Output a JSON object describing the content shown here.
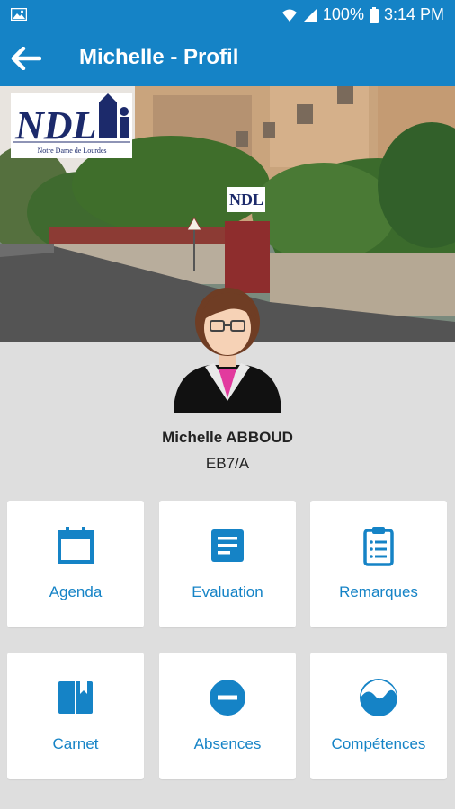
{
  "status_bar": {
    "battery": "100%",
    "time": "3:14 PM"
  },
  "app_bar": {
    "title": "Michelle - Profil"
  },
  "banner": {
    "logo_text": "NDL",
    "logo_subtitle": "Notre Dame de Lourdes"
  },
  "profile": {
    "name": "Michelle ABBOUD",
    "class": "EB7/A"
  },
  "tiles": [
    {
      "label": "Agenda",
      "icon": "calendar-icon"
    },
    {
      "label": "Evaluation",
      "icon": "document-icon"
    },
    {
      "label": "Remarques",
      "icon": "clipboard-icon"
    },
    {
      "label": "Carnet",
      "icon": "book-icon"
    },
    {
      "label": "Absences",
      "icon": "minus-circle-icon"
    },
    {
      "label": "Compétences",
      "icon": "wave-circle-icon"
    }
  ],
  "colors": {
    "primary": "#1583c6",
    "background": "#dedede",
    "tile": "#ffffff"
  }
}
